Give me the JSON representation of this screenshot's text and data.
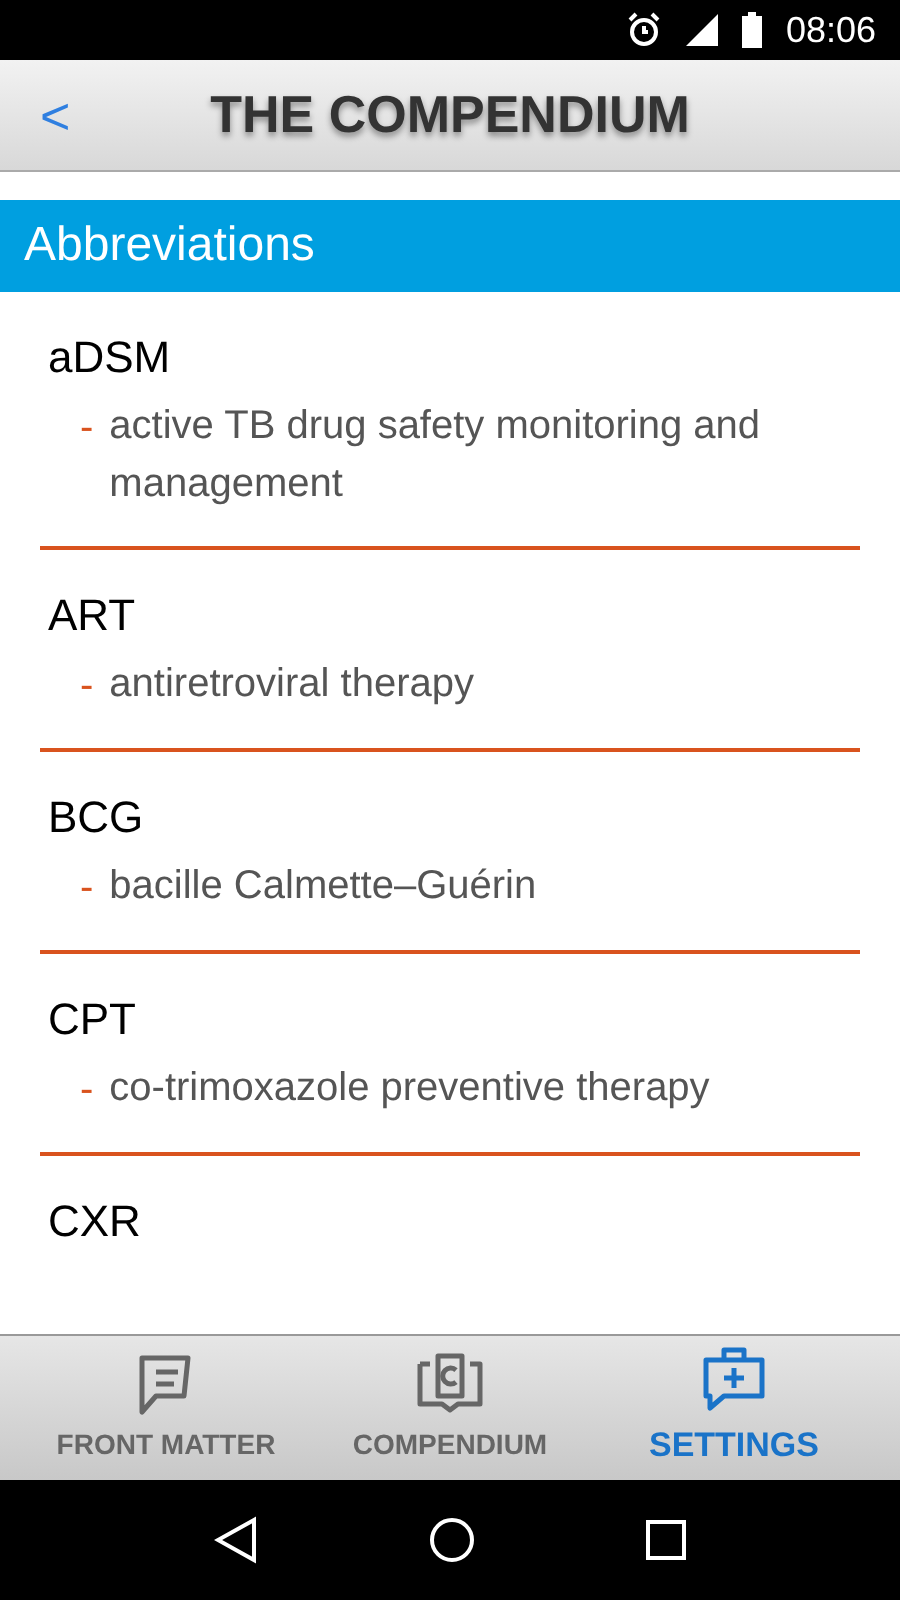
{
  "status_bar": {
    "time": "08:06"
  },
  "header": {
    "back": "<",
    "title": "THE COMPENDIUM"
  },
  "section": {
    "title": "Abbreviations"
  },
  "items": [
    {
      "term": "aDSM",
      "bullet": "-",
      "definition": "active TB drug safety monitoring and management"
    },
    {
      "term": "ART",
      "bullet": "-",
      "definition": "antiretroviral therapy"
    },
    {
      "term": "BCG",
      "bullet": "-",
      "definition": "bacille Calmette–Guérin"
    },
    {
      "term": "CPT",
      "bullet": "-",
      "definition": "co-trimoxazole preventive therapy"
    },
    {
      "term": "CXR"
    }
  ],
  "tabs": [
    {
      "label": "FRONT MATTER",
      "kind": "note",
      "selected": false
    },
    {
      "label": "COMPENDIUM",
      "kind": "book",
      "selected": false
    },
    {
      "label": "SETTINGS",
      "kind": "kit",
      "selected": true
    }
  ]
}
